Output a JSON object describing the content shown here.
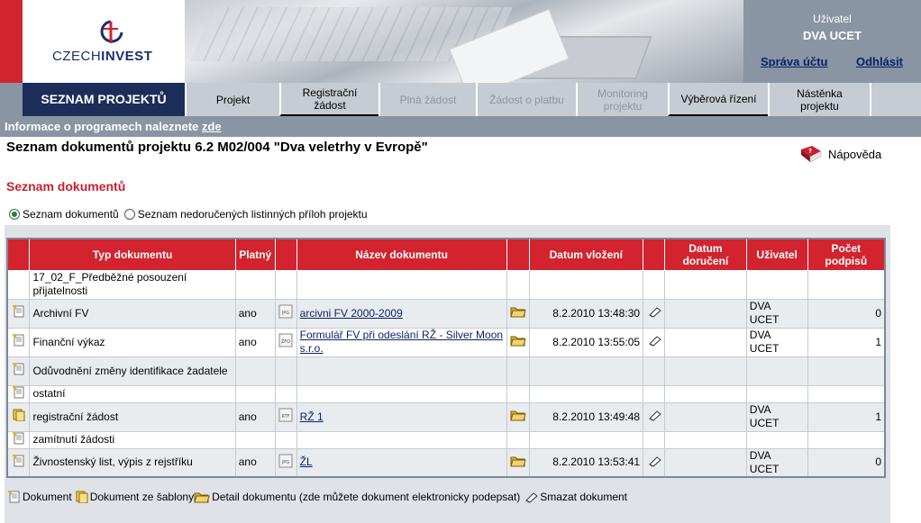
{
  "header": {
    "logo_text_a": "CZECH",
    "logo_text_b": "INVEST",
    "user_label": "Uživatel",
    "user_name": "DVA UCET",
    "account_link": "Správa účtu",
    "logout_link": "Odhlásit"
  },
  "nav": {
    "main": "SEZNAM PROJEKTŮ",
    "tabs": [
      {
        "label": "Projekt"
      },
      {
        "label": "Registrační\nžádost"
      },
      {
        "label": "Plná žádost"
      },
      {
        "label": "Žádost o platbu"
      },
      {
        "label": "Monitoring\nprojektu"
      },
      {
        "label": "Výběrová řízení"
      },
      {
        "label": "Nástěnka\nprojektu"
      }
    ]
  },
  "infobar": {
    "text": "Informace o programech naleznete ",
    "link": "zde"
  },
  "page": {
    "title": "Seznam dokumentů projektu  6.2 M02/004 \"Dva veletrhy v Evropě\"",
    "help": "Nápověda",
    "section_title": "Seznam dokumentů",
    "radio_1": "Seznam dokumentů",
    "radio_2": "Seznam nedoručených listinných příloh projektu"
  },
  "table": {
    "headers": {
      "type": "Typ dokumentu",
      "valid": "Platný",
      "name": "Název dokumentu",
      "inserted": "Datum vložení",
      "delivered": "Datum doručení",
      "user": "Uživatel",
      "signatures": "Počet podpisů"
    },
    "rows": [
      {
        "type": "17_02_F_Předběžné posouzení přijatelnosti",
        "valid": "",
        "name": "",
        "date": "",
        "user": "",
        "sig": ""
      },
      {
        "type": "Archivní FV",
        "valid": "ano",
        "name": "arcivni FV 2000-2009",
        "file": "JPG",
        "date": "8.2.2010 13:48:30",
        "user": "DVA UCET",
        "sig": "0"
      },
      {
        "type": "Finanční výkaz",
        "valid": "ano",
        "name": "Formulář FV při odeslání RŽ - Silver Moon s.r.o.",
        "file": "ZFO",
        "date": "8.2.2010 13:55:05",
        "user": "DVA UCET",
        "sig": "1"
      },
      {
        "type": "Odůvodnění změny identifikace žadatele",
        "valid": "",
        "name": "",
        "date": "",
        "user": "",
        "sig": ""
      },
      {
        "type": "ostatní",
        "valid": "",
        "name": "",
        "date": "",
        "user": "",
        "sig": ""
      },
      {
        "type": "registrační žádost",
        "valid": "ano",
        "name": "RŽ 1",
        "file": "RTF",
        "date": "8.2.2010 13:49:48",
        "user": "DVA UCET",
        "sig": "1"
      },
      {
        "type": "zamítnutí žádosti",
        "valid": "",
        "name": "",
        "date": "",
        "user": "",
        "sig": ""
      },
      {
        "type": "Živnostenský list, výpis z rejstříku",
        "valid": "ano",
        "name": "ŽL",
        "file": "JPG",
        "date": "8.2.2010 13:53:41",
        "user": "DVA UCET",
        "sig": "0"
      }
    ]
  },
  "legend": {
    "doc": "Dokument",
    "template": "Dokument ze šablony",
    "detail": "Detail dokumentu (zde můžete dokument elektronicky podepsat)",
    "delete": "Smazat dokument"
  },
  "colors": {
    "accent_red": "#d2232f",
    "nav_dark": "#1c2d5a",
    "header_gray": "#8995a3"
  }
}
